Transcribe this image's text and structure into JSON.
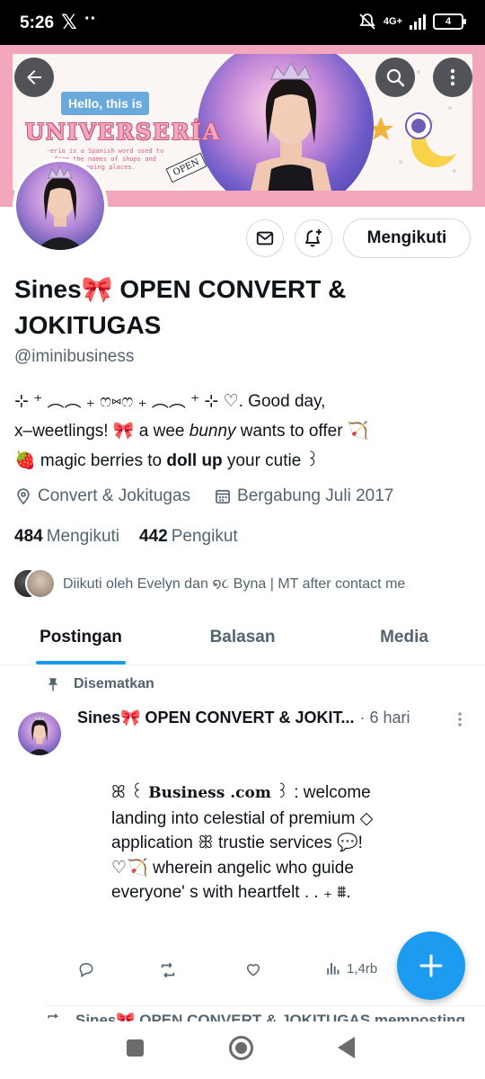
{
  "status_bar": {
    "time": "5:26",
    "x_logo": "𝕏",
    "dots": "··",
    "network": "4G+",
    "battery": "4"
  },
  "banner": {
    "greeting": "Hello, this is",
    "title": "UNIVERSERÍA",
    "caption": "-ería is a Spanish word used to form the names of shops and shopping places.",
    "sign": "OPEN",
    "colors": {
      "frame": "#f3a7bd",
      "title": "#f7a6bf",
      "greeting_bg": "#6aa9dc"
    }
  },
  "profile": {
    "name": "Sines🎀 OPEN CONVERT & JOKITUGAS",
    "handle": "@iminibusiness",
    "bio": {
      "line1": "⊹ ⁺  ︵︵ ₊ ෆ⑅ෆ ₊ ︵︵  ⁺ ⊹   ♡. Good day,",
      "line2_a": "x–weetlings! 🎀   a wee ",
      "line2_b": "bunny",
      "line2_c": " wants to offer   🏹",
      "line3_a": "🍓  magic berries to ",
      "line3_b": "doll up",
      "line3_c": "   your cutie ꒱"
    },
    "location": "Convert & Jokitugas",
    "joined": "Bergabung Juli 2017",
    "following_count": "484",
    "following_label": "Mengikuti",
    "followers_count": "442",
    "followers_label": "Pengikut",
    "followed_by": "Diikuti oleh Evelyn dan ໑૮ Byna | MT after contact me",
    "follow_button": "Mengikuti"
  },
  "tabs": [
    {
      "label": "Postingan",
      "active": true
    },
    {
      "label": "Balasan",
      "active": false
    },
    {
      "label": "Media",
      "active": false
    }
  ],
  "pinned_post": {
    "pinned_label": "Disematkan",
    "author": "Sines🎀 OPEN CONVERT & JOKIT...",
    "time": "· 6 hari",
    "body_line1_a": "ꕤ ꒰ ",
    "body_line1_b": "Business .com",
    "body_line1_c": " ꒱ :  welcome",
    "body_line2": "landing into celestial of premium ◇",
    "body_line3": "application ꕥ trustie services 💬!",
    "body_line4": "♡🏹 wherein angelic who guide",
    "body_line5": "everyone' s  with  heartfelt  . . ₊ ⩩.",
    "views": "1,4rb"
  },
  "next_post": {
    "repost_text": "Sines🎀 OPEN CONVERT & JOKITUGAS memposting"
  },
  "accent_color": "#1d9bf0",
  "icons": [
    "back-arrow-icon",
    "search-icon",
    "more-vert-icon",
    "mail-icon",
    "bell-plus-icon",
    "location-icon",
    "calendar-icon",
    "pin-icon",
    "reply-icon",
    "repost-icon",
    "like-icon",
    "views-icon",
    "plus-icon"
  ]
}
